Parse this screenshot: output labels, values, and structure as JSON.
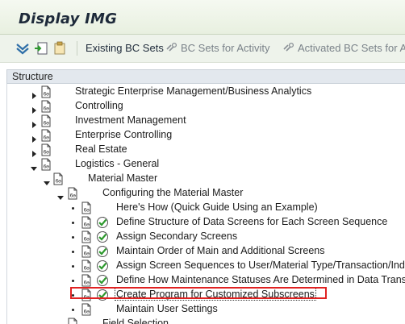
{
  "window": {
    "title": "Display IMG"
  },
  "toolbar": {
    "existing_bc_sets": "Existing BC Sets",
    "bc_sets_for_activity": "BC Sets for Activity",
    "activated_bc_sets": "Activated BC Sets for Ac"
  },
  "structure": {
    "header": "Structure",
    "rows": [
      {
        "label": "Strategic Enterprise Management/Business Analytics",
        "level": 1,
        "kind": "folder",
        "expanded": false
      },
      {
        "label": "Controlling",
        "level": 1,
        "kind": "folder",
        "expanded": false
      },
      {
        "label": "Investment Management",
        "level": 1,
        "kind": "folder",
        "expanded": false
      },
      {
        "label": "Enterprise Controlling",
        "level": 1,
        "kind": "folder",
        "expanded": false
      },
      {
        "label": "Real Estate",
        "level": 1,
        "kind": "folder",
        "expanded": false
      },
      {
        "label": "Logistics - General",
        "level": 1,
        "kind": "folder",
        "expanded": true
      },
      {
        "label": "Material Master",
        "level": 2,
        "kind": "folder",
        "expanded": true
      },
      {
        "label": "Configuring the Material Master",
        "level": 3,
        "kind": "folder",
        "expanded": true
      },
      {
        "label": "Here's How (Quick Guide Using an Example)",
        "level": 4,
        "kind": "doc"
      },
      {
        "label": "Define Structure of Data Screens for Each Screen Sequence",
        "level": 4,
        "kind": "activity"
      },
      {
        "label": "Assign Secondary Screens",
        "level": 4,
        "kind": "activity"
      },
      {
        "label": "Maintain Order of Main and Additional Screens",
        "level": 4,
        "kind": "activity"
      },
      {
        "label": "Assign Screen Sequences to User/Material Type/Transaction/Indu",
        "level": 4,
        "kind": "activity"
      },
      {
        "label": "Define How Maintenance Statuses Are Determined in Data Transf",
        "level": 4,
        "kind": "activity"
      },
      {
        "label": "Create Program for Customized Subscreens",
        "level": 4,
        "kind": "activity",
        "selected": true
      },
      {
        "label": "Maintain User Settings",
        "level": 4,
        "kind": "doc"
      },
      {
        "label": "Field Selection",
        "level": 3,
        "kind": "folder",
        "expanded": false
      }
    ]
  },
  "colors": {
    "highlight_box": "#e02222",
    "exec_check": "#2e9a2e",
    "titlebar": "#eef3eb"
  }
}
